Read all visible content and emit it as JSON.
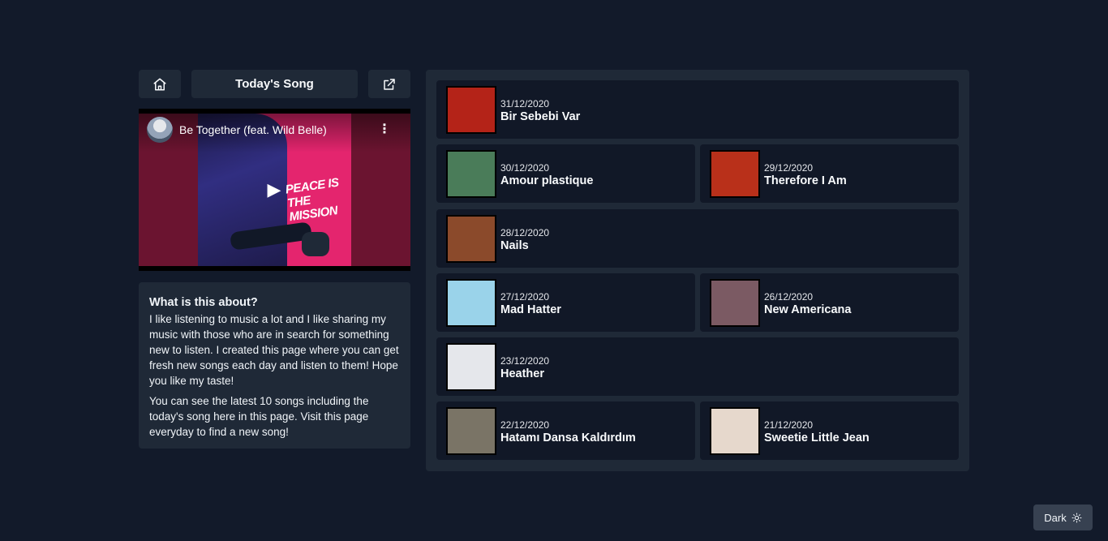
{
  "header": {
    "title": "Today's Song",
    "home_icon": "home-icon",
    "external_icon": "external-link-icon"
  },
  "video": {
    "title": "Be Together (feat. Wild Belle)",
    "art_text": "PEACE IS THE MISSION",
    "menu_icon": "more-vertical-icon",
    "play_icon": "play-icon"
  },
  "about": {
    "heading": "What is this about?",
    "paragraph1": "I like listening to music a lot and I like sharing my music with those who are in search for something new to listen. I created this page where you can get fresh new songs each day and listen to them! Hope you like my taste!",
    "paragraph2": "You can see the latest 10 songs including the today's song here in this page. Visit this page everyday to find a new song!"
  },
  "songs": [
    {
      "date": "31/12/2020",
      "title": "Bir Sebebi Var",
      "color": "#b42318"
    },
    {
      "date": "30/12/2020",
      "title": "Amour plastique",
      "color": "#4a7c59"
    },
    {
      "date": "29/12/2020",
      "title": "Therefore I Am",
      "color": "#b9301a"
    },
    {
      "date": "28/12/2020",
      "title": "Nails",
      "color": "#8b4a2b"
    },
    {
      "date": "27/12/2020",
      "title": "Mad Hatter",
      "color": "#9ad3ea"
    },
    {
      "date": "26/12/2020",
      "title": "New Americana",
      "color": "#7b5a63"
    },
    {
      "date": "23/12/2020",
      "title": "Heather",
      "color": "#e5e7eb"
    },
    {
      "date": "22/12/2020",
      "title": "Hatamı Dansa Kaldırdım",
      "color": "#7a7466"
    },
    {
      "date": "21/12/2020",
      "title": "Sweetie Little Jean",
      "color": "#e6d8cc"
    }
  ],
  "theme_toggle": {
    "label": "Dark",
    "icon": "sun-icon"
  }
}
